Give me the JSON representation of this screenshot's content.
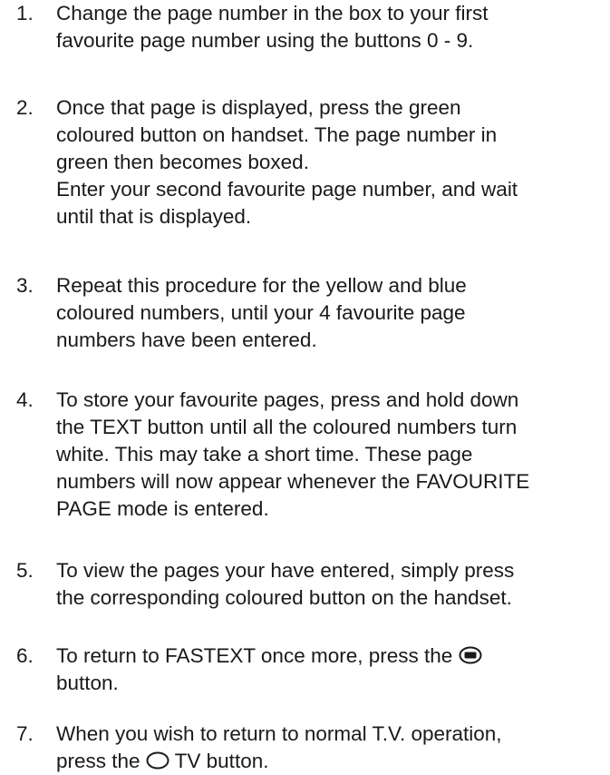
{
  "steps": [
    {
      "number": "1.",
      "text": "Change the page number in the box to your first\nfavourite page number using the buttons 0 - 9."
    },
    {
      "number": "2.",
      "text": "Once that page is displayed, press the green\ncoloured button on handset. The page number in\ngreen then becomes boxed.\nEnter your second favourite page number, and wait\nuntil that is displayed."
    },
    {
      "number": "3.",
      "text": "Repeat this procedure for the yellow and blue\ncoloured numbers, until your 4 favourite page\nnumbers have been entered."
    },
    {
      "number": "4.",
      "text": "To store your favourite pages, press and hold down\nthe TEXT button until all the coloured numbers turn\nwhite. This may take a short time. These page\nnumbers will now appear whenever the FAVOURITE\nPAGE mode is entered."
    },
    {
      "number": "5.",
      "text": "To view the pages your have entered, simply press\nthe corresponding coloured button on the handset."
    },
    {
      "number": "6.",
      "text_before_icon": "To return to FASTEXT once more, press the ",
      "icon": "fastext-button-icon",
      "text_after_icon": "\nbutton."
    },
    {
      "number": "7.",
      "text_before_icon": "When you wish to return to normal T.V. operation,\npress the ",
      "icon": "tv-button-icon",
      "text_after_icon": " TV button."
    }
  ]
}
